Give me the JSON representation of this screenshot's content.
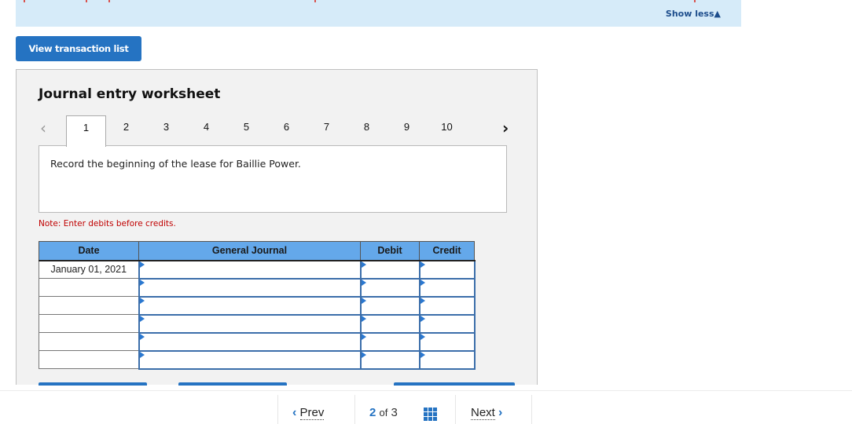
{
  "banner": {
    "show_less_label": "Show less",
    "show_less_icon": "triangle-up-icon"
  },
  "toolbar": {
    "view_transaction_list_label": "View transaction list"
  },
  "worksheet": {
    "title": "Journal entry worksheet",
    "tabs": [
      "1",
      "2",
      "3",
      "4",
      "5",
      "6",
      "7",
      "8",
      "9",
      "10"
    ],
    "active_tab": "1",
    "prev_icon": "chevron-left-icon",
    "next_icon": "chevron-right-icon",
    "prompt": "Record the beginning of the lease for Baillie Power.",
    "note": "Note: Enter debits before credits.",
    "colors": {
      "header_bg": "#64a8ea",
      "note": "#c00000",
      "accent": "#2573c2"
    }
  },
  "journal": {
    "headers": {
      "date": "Date",
      "general_journal": "General Journal",
      "debit": "Debit",
      "credit": "Credit"
    },
    "rows": [
      {
        "date": "January 01, 2021",
        "account": "",
        "debit": "",
        "credit": ""
      },
      {
        "date": "",
        "account": "",
        "debit": "",
        "credit": ""
      },
      {
        "date": "",
        "account": "",
        "debit": "",
        "credit": ""
      },
      {
        "date": "",
        "account": "",
        "debit": "",
        "credit": ""
      },
      {
        "date": "",
        "account": "",
        "debit": "",
        "credit": ""
      },
      {
        "date": "",
        "account": "",
        "debit": "",
        "credit": ""
      }
    ]
  },
  "pagination": {
    "prev_label": "Prev",
    "next_label": "Next",
    "current": "2",
    "of_label": "of",
    "total": "3",
    "grid_icon": "grid-icon"
  }
}
